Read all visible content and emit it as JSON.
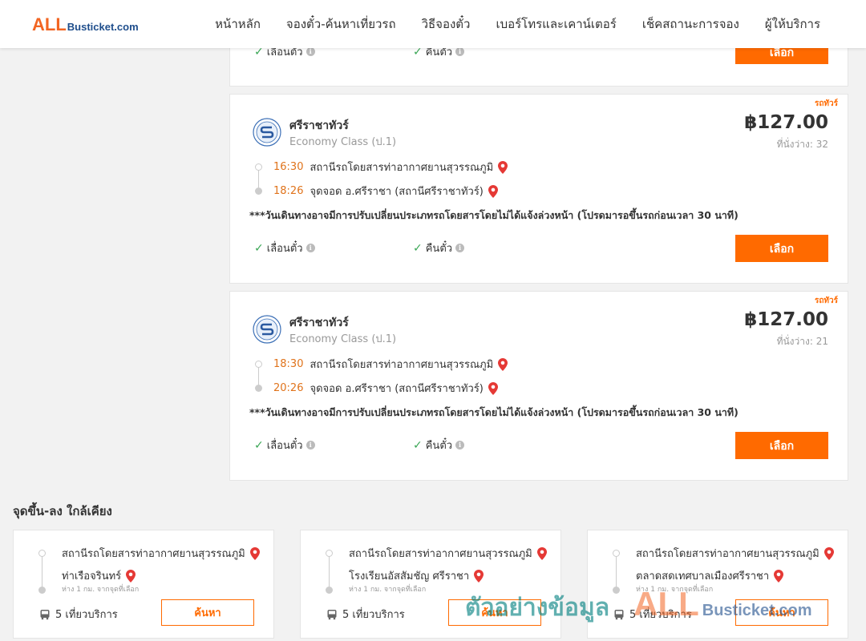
{
  "logo": {
    "all": "ALL",
    "rest": "Busticket.com"
  },
  "nav": [
    "หน้าหลัก",
    "จองตั๋ว-ค้นหาเที่ยวรถ",
    "วิธีจองตั๋ว",
    "เบอร์โทรและเคาน์เตอร์",
    "เช็คสถานะการจอง",
    "ผู้ให้บริการ"
  ],
  "features": {
    "reschedule": "เลื่อนตั๋ว",
    "refund": "คืนตั๋ว"
  },
  "select_label": "เลือก",
  "trips": [
    {
      "tag": "รถทัวร์",
      "operator": "ศรีราชาทัวร์",
      "class": "Economy Class (ป.1)",
      "price": "฿127.00",
      "seats": "ที่นั่งว่าง: 32",
      "depart_time": "16:30",
      "depart_stop": "สถานีรถโดยสารท่าอากาศยานสุวรรณภูมิ",
      "arrive_time": "18:26",
      "arrive_stop": "จุดจอด อ.ศรีราชา (สถานีศรีราชาทัวร์)",
      "notice": "***วันเดินทางอาจมีการปรับเปลี่ยนประเภทรถโดยสารโดยไม่ได้แจ้งล่วงหน้า (โปรดมารอขึ้นรถก่อนเวลา 30 นาที)"
    },
    {
      "tag": "รถทัวร์",
      "operator": "ศรีราชาทัวร์",
      "class": "Economy Class (ป.1)",
      "price": "฿127.00",
      "seats": "ที่นั่งว่าง: 21",
      "depart_time": "18:30",
      "depart_stop": "สถานีรถโดยสารท่าอากาศยานสุวรรณภูมิ",
      "arrive_time": "20:26",
      "arrive_stop": "จุดจอด อ.ศรีราชา (สถานีศรีราชาทัวร์)",
      "notice": "***วันเดินทางอาจมีการปรับเปลี่ยนประเภทรถโดยสารโดยไม่ได้แจ้งล่วงหน้า (โปรดมารอขึ้นรถก่อนเวลา 30 นาที)"
    }
  ],
  "nearby": {
    "title": "จุดขึ้น-ลง ใกล้เคียง",
    "search_label": "ค้นหา",
    "items": [
      {
        "from": "สถานีรถโดยสารท่าอากาศยานสุวรรณภูมิ",
        "to": "ท่าเรือจรินทร์",
        "distance": "ห่าง 1 กม. จากจุดที่เลือก",
        "services": "5 เที่ยวบริการ"
      },
      {
        "from": "สถานีรถโดยสารท่าอากาศยานสุวรรณภูมิ",
        "to": "โรงเรียนอัสสัมชัญ ศรีราชา",
        "distance": "ห่าง 1 กม. จากจุดที่เลือก",
        "services": "5 เที่ยวบริการ"
      },
      {
        "from": "สถานีรถโดยสารท่าอากาศยานสุวรรณภูมิ",
        "to": "ตลาดสดเทศบาลเมืองศรีราชา",
        "distance": "ห่าง 1 กม. จากจุดที่เลือก",
        "services": "5 เที่ยวบริการ"
      }
    ]
  },
  "watermark": {
    "thai": "ตัวอย่างข้อมูล",
    "all": "ALL",
    "rest": "Busticket.com"
  },
  "colors": {
    "accent": "#ff6a00",
    "time": "#e0731b",
    "check": "#3aa655",
    "pin": "#e53935",
    "brand_blue": "#1f4e8c"
  }
}
